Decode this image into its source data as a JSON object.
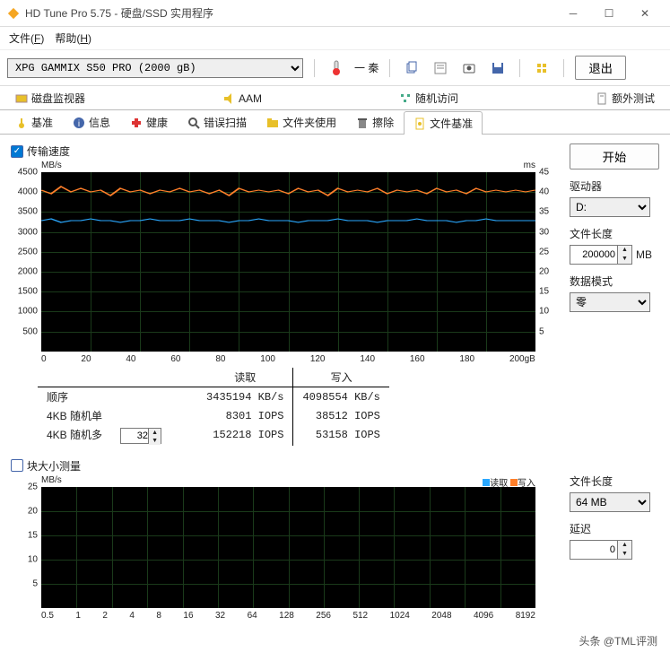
{
  "window": {
    "title": "HD Tune Pro 5.75 - 硬盘/SSD 实用程序"
  },
  "menu": {
    "file": "文件(F)",
    "help": "帮助(H)"
  },
  "toolbar": {
    "drive": "XPG GAMMIX S50 PRO (2000 gB)",
    "temp_label": "一 秦",
    "exit": "退出"
  },
  "tabs1": [
    {
      "label": "磁盘监视器"
    },
    {
      "label": "AAM"
    },
    {
      "label": "随机访问"
    },
    {
      "label": "额外测试"
    }
  ],
  "tabs2": [
    {
      "label": "基准"
    },
    {
      "label": "信息"
    },
    {
      "label": "健康"
    },
    {
      "label": "错误扫描"
    },
    {
      "label": "文件夹使用"
    },
    {
      "label": "擦除"
    },
    {
      "label": "文件基准"
    }
  ],
  "chk1": {
    "label": "传输速度"
  },
  "chk2": {
    "label": "块大小测量"
  },
  "chart1": {
    "y_unit": "MB/s",
    "y2_unit": "ms",
    "y_ticks": [
      "4500",
      "4000",
      "3500",
      "3000",
      "2500",
      "2000",
      "1500",
      "1000",
      "500"
    ],
    "y2_ticks": [
      "45",
      "40",
      "35",
      "30",
      "25",
      "20",
      "15",
      "10",
      "5"
    ],
    "x_ticks": [
      "0",
      "20",
      "40",
      "60",
      "80",
      "100",
      "120",
      "140",
      "160",
      "180",
      "200gB"
    ]
  },
  "chart2": {
    "y_unit": "MB/s",
    "y_ticks": [
      "25",
      "20",
      "15",
      "10",
      "5"
    ],
    "x_ticks": [
      "0.5",
      "1",
      "2",
      "4",
      "8",
      "16",
      "32",
      "64",
      "128",
      "256",
      "512",
      "1024",
      "2048",
      "4096",
      "8192"
    ],
    "legend_read": "读取",
    "legend_write": "写入"
  },
  "results": {
    "hdr_read": "读取",
    "hdr_write": "写入",
    "rows": [
      {
        "label": "顺序",
        "read": "3435194 KB/s",
        "write": "4098554 KB/s"
      },
      {
        "label": "4KB 随机单",
        "read": "8301 IOPS",
        "write": "38512 IOPS"
      },
      {
        "label": "4KB 随机多",
        "read": "152218 IOPS",
        "write": "53158 IOPS"
      }
    ],
    "queue_depth": "32"
  },
  "side": {
    "start": "开始",
    "driver": "驱动器",
    "driver_val": "D:",
    "file_len": "文件长度",
    "file_len_val": "200000",
    "file_len_unit": "MB",
    "data_mode": "数据模式",
    "data_mode_val": "零",
    "file_len2": "文件长度",
    "file_len2_val": "64 MB",
    "delay": "延迟",
    "delay_val": "0"
  },
  "watermark": "头条 @TML评测",
  "chart_data": {
    "type": "line",
    "title": "传输速度",
    "xlabel": "gB",
    "ylabel": "MB/s",
    "y2label": "ms",
    "xlim": [
      0,
      200
    ],
    "ylim": [
      0,
      4500
    ],
    "y2lim": [
      0,
      45
    ],
    "x": [
      0,
      10,
      20,
      30,
      40,
      50,
      60,
      70,
      80,
      90,
      100,
      110,
      120,
      130,
      140,
      150,
      160,
      170,
      180,
      190,
      200
    ],
    "series": [
      {
        "name": "写入",
        "color": "#ff7f2a",
        "values": [
          4050,
          4000,
          4100,
          3950,
          4050,
          4000,
          4000,
          4050,
          3900,
          4100,
          4050,
          3950,
          4000,
          4050,
          4000,
          4050,
          4000,
          3950,
          4100,
          4000,
          4050
        ]
      },
      {
        "name": "读取",
        "color": "#2aa8ff",
        "values": [
          3250,
          3300,
          3250,
          3280,
          3300,
          3250,
          3300,
          3280,
          3260,
          3300,
          3250,
          3280,
          3300,
          3250,
          3280,
          3300,
          3260,
          3280,
          3300,
          3250,
          3280
        ]
      }
    ]
  }
}
